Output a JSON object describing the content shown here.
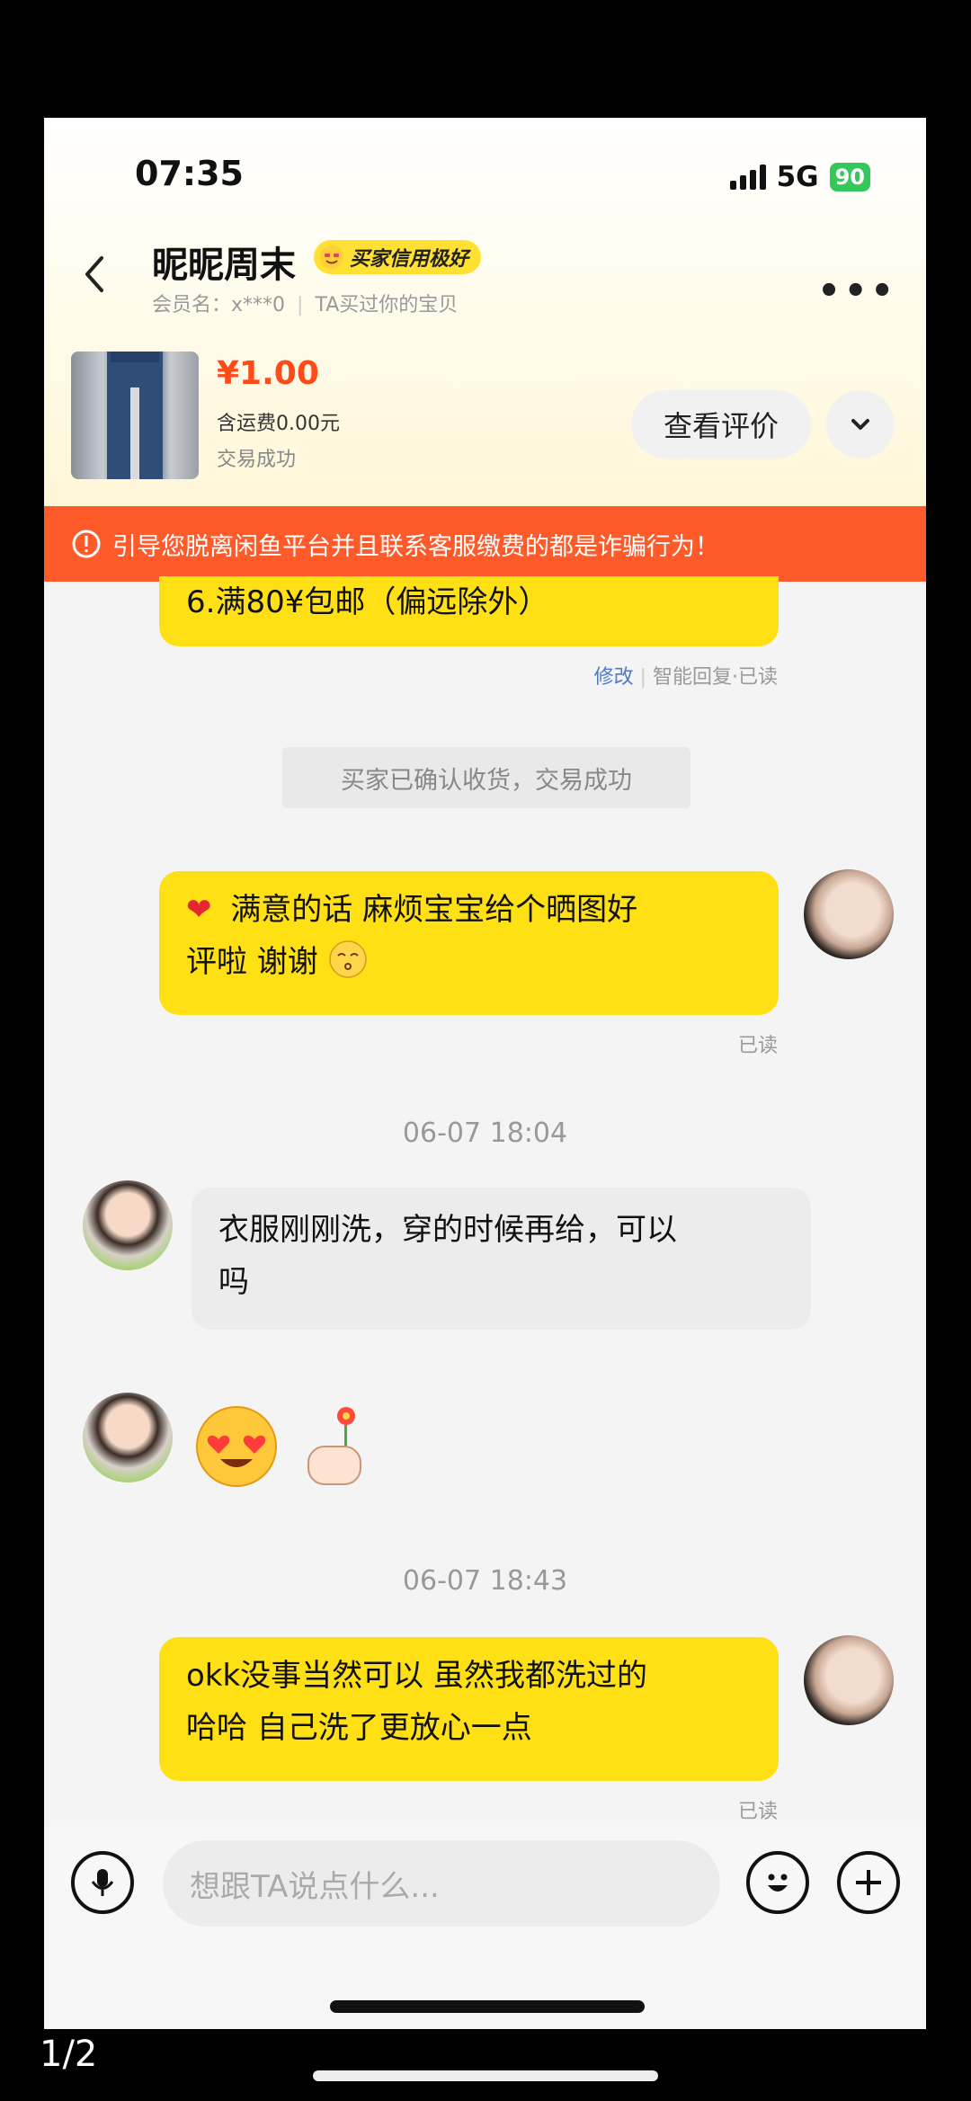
{
  "status_bar": {
    "time": "07:35",
    "network": "5G",
    "battery": "90"
  },
  "header": {
    "title": "昵昵周末",
    "badge": "买家信用极好",
    "member_label": "会员名：",
    "member_name": "x***0",
    "bought_note": "TA买过你的宝贝"
  },
  "product": {
    "price": "¥1.00",
    "shipping": "含运费0.00元",
    "status": "交易成功",
    "review_button": "查看评价"
  },
  "warning": "引导您脱离闲鱼平台并且联系客服缴费的都是诈骗行为！",
  "messages": [
    {
      "side": "me",
      "text": "6.满80¥包邮（偏远除外）",
      "meta_edit": "修改",
      "meta_info": "智能回复·已读"
    },
    {
      "type": "system",
      "text": "买家已确认收货，交易成功"
    },
    {
      "side": "me",
      "text_line1": "满意的话 麻烦宝宝给个晒图好",
      "text_line2": "评啦 谢谢",
      "read": "已读"
    },
    {
      "type": "timestamp",
      "text": "06-07 18:04"
    },
    {
      "side": "other",
      "text_line1": "衣服刚刚洗，穿的时候再给，可以",
      "text_line2": "吗"
    },
    {
      "side": "other",
      "emojis": [
        "heart-eyes-emoji",
        "thumbs-flower-emoji"
      ]
    },
    {
      "type": "timestamp",
      "text": "06-07 18:43"
    },
    {
      "side": "me",
      "text_line1": "okk没事当然可以 虽然我都洗过的",
      "text_line2": "哈哈 自己洗了更放心一点",
      "read": "已读"
    }
  ],
  "input": {
    "placeholder": "想跟TA说点什么..."
  },
  "page_indicator": "1/2",
  "colors": {
    "accent_yellow": "#ffe014",
    "warning": "#ff5a2a",
    "price": "#ff4a1a"
  }
}
